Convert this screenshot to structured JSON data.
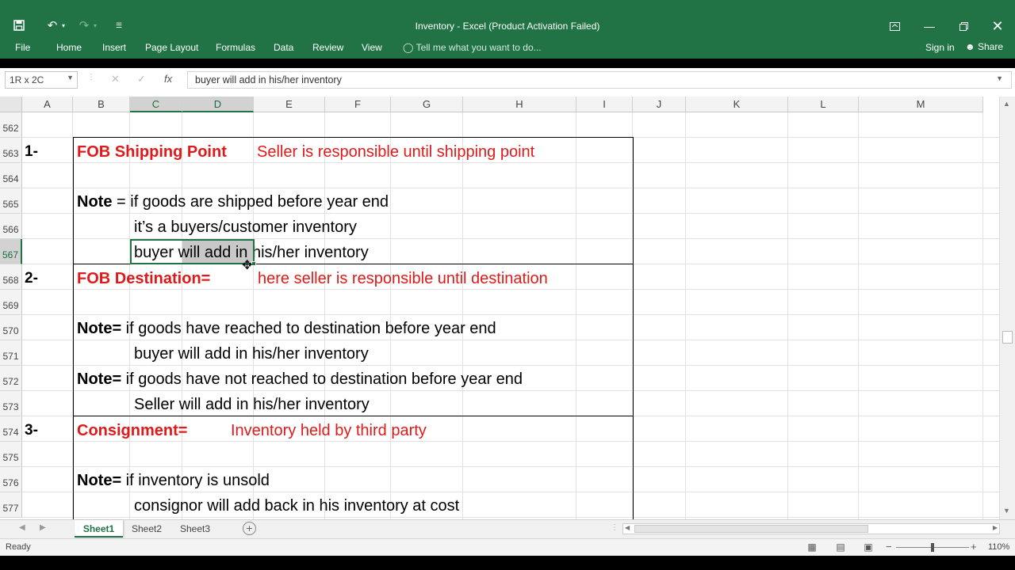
{
  "window": {
    "title": "Inventory - Excel (Product Activation Failed)",
    "icons": {
      "save": "save-icon",
      "undo": "undo-icon",
      "redo": "redo-icon",
      "customize": "customize-qat-icon",
      "ribbon_display": "ribbon-display-icon"
    }
  },
  "ribbon": {
    "tabs": [
      "File",
      "Home",
      "Insert",
      "Page Layout",
      "Formulas",
      "Data",
      "Review",
      "View"
    ],
    "tell_me": "Tell me what you want to do...",
    "sign_in": "Sign in",
    "share": "Share"
  },
  "formula_bar": {
    "name_box": "1R x 2C",
    "fx": "fx",
    "content": "buyer will add in his/her inventory"
  },
  "grid": {
    "columns": [
      "A",
      "B",
      "C",
      "D",
      "E",
      "F",
      "G",
      "H",
      "I",
      "J",
      "K",
      "L",
      "M"
    ],
    "selected_columns": [
      "C",
      "D"
    ],
    "rows": [
      "562",
      "563",
      "564",
      "565",
      "566",
      "567",
      "568",
      "569",
      "570",
      "571",
      "572",
      "573",
      "574",
      "575",
      "576",
      "577"
    ],
    "selected_row": "567"
  },
  "cells": {
    "r563_a": "1-",
    "r563_b": "FOB Shipping Point",
    "r563_e": "Seller is responsible until shipping point",
    "r565_b_bold": "Note",
    "r565_b_rest": " = if goods are shipped before year end",
    "r566_c": "it’s a buyers/customer inventory",
    "r567_c_pre": "buyer ",
    "r567_c_sel": "will add ",
    "r567_c_post": "in his/her inventory",
    "r568_a": "2-",
    "r568_b": "FOB Destination=",
    "r568_e": "here seller is responsible until destination",
    "r570_b_bold": "Note=",
    "r570_b_rest": " if goods have reached to destination before year end",
    "r571_c": "buyer will add in his/her inventory",
    "r572_b_bold": "Note=",
    "r572_b_rest": " if goods have not reached to destination before year end",
    "r573_c": "Seller will add in his/her inventory",
    "r574_a": "3-",
    "r574_b": "Consignment=",
    "r574_e": "Inventory held by third party",
    "r576_b_bold": "Note=",
    "r576_b_rest": " if inventory is unsold",
    "r577_c": "consignor will add back in his inventory at cost"
  },
  "sheets": {
    "tabs": [
      "Sheet1",
      "Sheet2",
      "Sheet3"
    ],
    "active": "Sheet1"
  },
  "status": {
    "ready": "Ready",
    "zoom": "110%",
    "zoom_fraction": 0.5
  },
  "colors": {
    "excel_green": "#217346",
    "red_text": "#e01a1a"
  }
}
